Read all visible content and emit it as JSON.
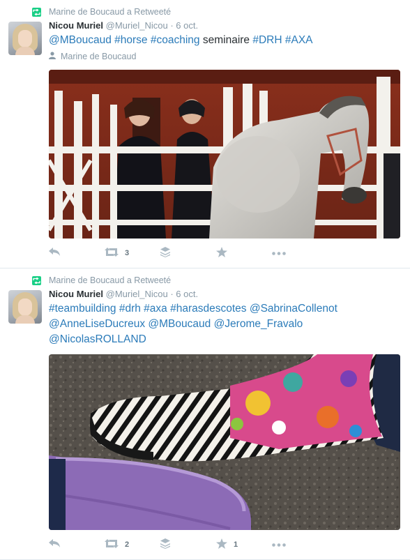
{
  "tweets": [
    {
      "retweet_context": "Marine de Boucaud a Retweeté",
      "fullname": "Nicou Muriel",
      "username": "@Muriel_Nicou",
      "separator": "·",
      "timestamp": "6 oct.",
      "text_parts": [
        {
          "text": "@MBoucaud",
          "link": true
        },
        {
          "text": " ",
          "link": false
        },
        {
          "text": "#horse",
          "link": true
        },
        {
          "text": " ",
          "link": false
        },
        {
          "text": "#coaching",
          "link": true
        },
        {
          "text": " seminaire ",
          "link": false
        },
        {
          "text": "#DRH",
          "link": true
        },
        {
          "text": " ",
          "link": false
        },
        {
          "text": "#AXA",
          "link": true
        }
      ],
      "mentioned_user": "Marine de Boucaud",
      "retweet_count": "3",
      "favorite_count": "",
      "image_icon": "photo-horse-paddock"
    },
    {
      "retweet_context": "Marine de Boucaud a Retweeté",
      "fullname": "Nicou Muriel",
      "username": "@Muriel_Nicou",
      "separator": "·",
      "timestamp": "6 oct.",
      "text_parts": [
        {
          "text": "#teambuilding",
          "link": true
        },
        {
          "text": " ",
          "link": false
        },
        {
          "text": "#drh",
          "link": true
        },
        {
          "text": " ",
          "link": false
        },
        {
          "text": "#axa",
          "link": true
        },
        {
          "text": " ",
          "link": false
        },
        {
          "text": "#harasdescotes",
          "link": true
        },
        {
          "text": "  ",
          "link": false
        },
        {
          "text": "@SabrinaCollenot",
          "link": true
        },
        {
          "text": " ",
          "link": false
        },
        {
          "text": "@AnneLiseDucreux",
          "link": true
        },
        {
          "text": " ",
          "link": false
        },
        {
          "text": "@MBoucaud",
          "link": true
        },
        {
          "text": " ",
          "link": false
        },
        {
          "text": "@Jerome_Fravalo",
          "link": true
        },
        {
          "text": " ",
          "link": false
        },
        {
          "text": "@NicolasROLLAND",
          "link": true
        }
      ],
      "retweet_count": "2",
      "favorite_count": "1",
      "image_icon": "photo-rain-boots"
    }
  ],
  "colors": {
    "link": "#2b7bb9",
    "muted": "#8899a6",
    "retweet_green": "#19cf86",
    "action_grey": "#aab8c2"
  },
  "icons": {
    "retweet_badge": "retweet-icon",
    "reply": "reply-icon",
    "retweet": "retweet-icon",
    "stack": "stack-icon",
    "favorite": "star-icon",
    "more": "more-dots-icon",
    "user": "user-icon"
  }
}
